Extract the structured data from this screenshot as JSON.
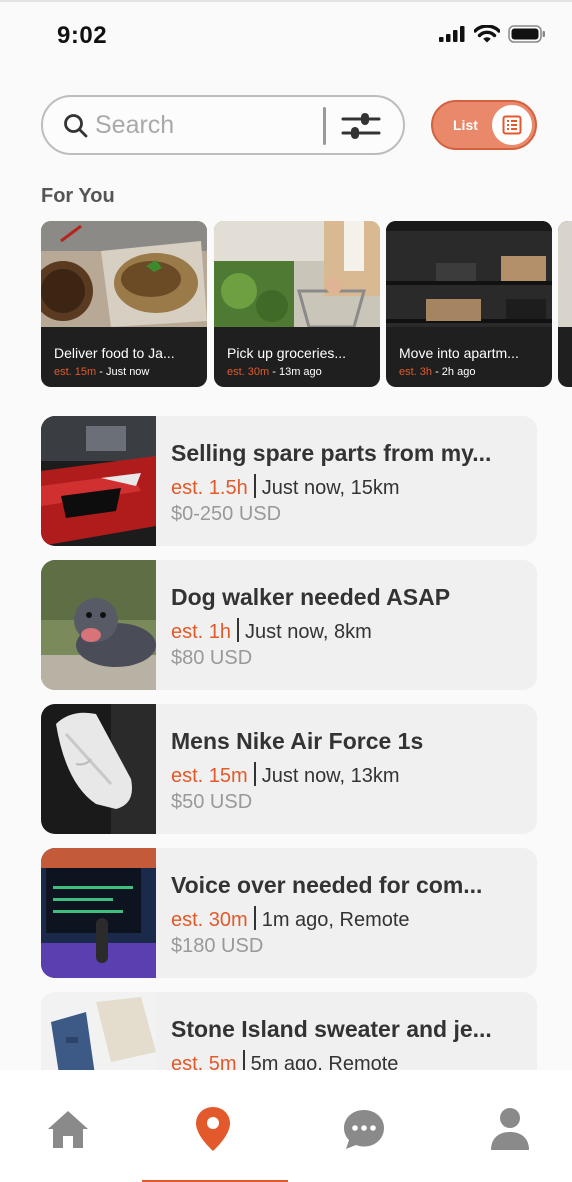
{
  "status": {
    "time": "9:02"
  },
  "search": {
    "placeholder": "Search"
  },
  "view_toggle": {
    "label": "List"
  },
  "for_you": {
    "title": "For You",
    "cards": [
      {
        "title": "Deliver food to Ja...",
        "est": "est. 15m",
        "time": " - Just now"
      },
      {
        "title": "Pick up groceries...",
        "est": "est. 30m",
        "time": " - 13m ago"
      },
      {
        "title": "Move into apartm...",
        "est": "est. 3h",
        "time": " - 2h ago"
      }
    ]
  },
  "listings": [
    {
      "title": "Selling spare parts from my...",
      "est": "est. 1.5h",
      "details": "Just now, 15km",
      "price": "$0-250 USD"
    },
    {
      "title": "Dog walker needed ASAP",
      "est": "est. 1h",
      "details": "Just now, 8km",
      "price": "$80 USD"
    },
    {
      "title": "Mens Nike Air Force 1s",
      "est": "est. 15m",
      "details": "Just now, 13km",
      "price": "$50 USD"
    },
    {
      "title": "Voice over needed for com...",
      "est": "est. 30m",
      "details": "1m ago, Remote",
      "price": "$180 USD"
    },
    {
      "title": "Stone Island sweater and je...",
      "est": "est. 5m",
      "details": "5m ago, Remote",
      "price": ""
    }
  ],
  "nav": {
    "active": "map"
  },
  "colors": {
    "accent": "#e25a2c",
    "toggle_bg": "#e9896a",
    "card_bg": "#1f1f1f",
    "item_bg": "#f0f0f0"
  },
  "icons": [
    "signal-icon",
    "wifi-icon",
    "battery-icon",
    "search-icon",
    "filter-icon",
    "list-icon",
    "home-icon",
    "map-pin-icon",
    "chat-icon",
    "profile-icon"
  ]
}
